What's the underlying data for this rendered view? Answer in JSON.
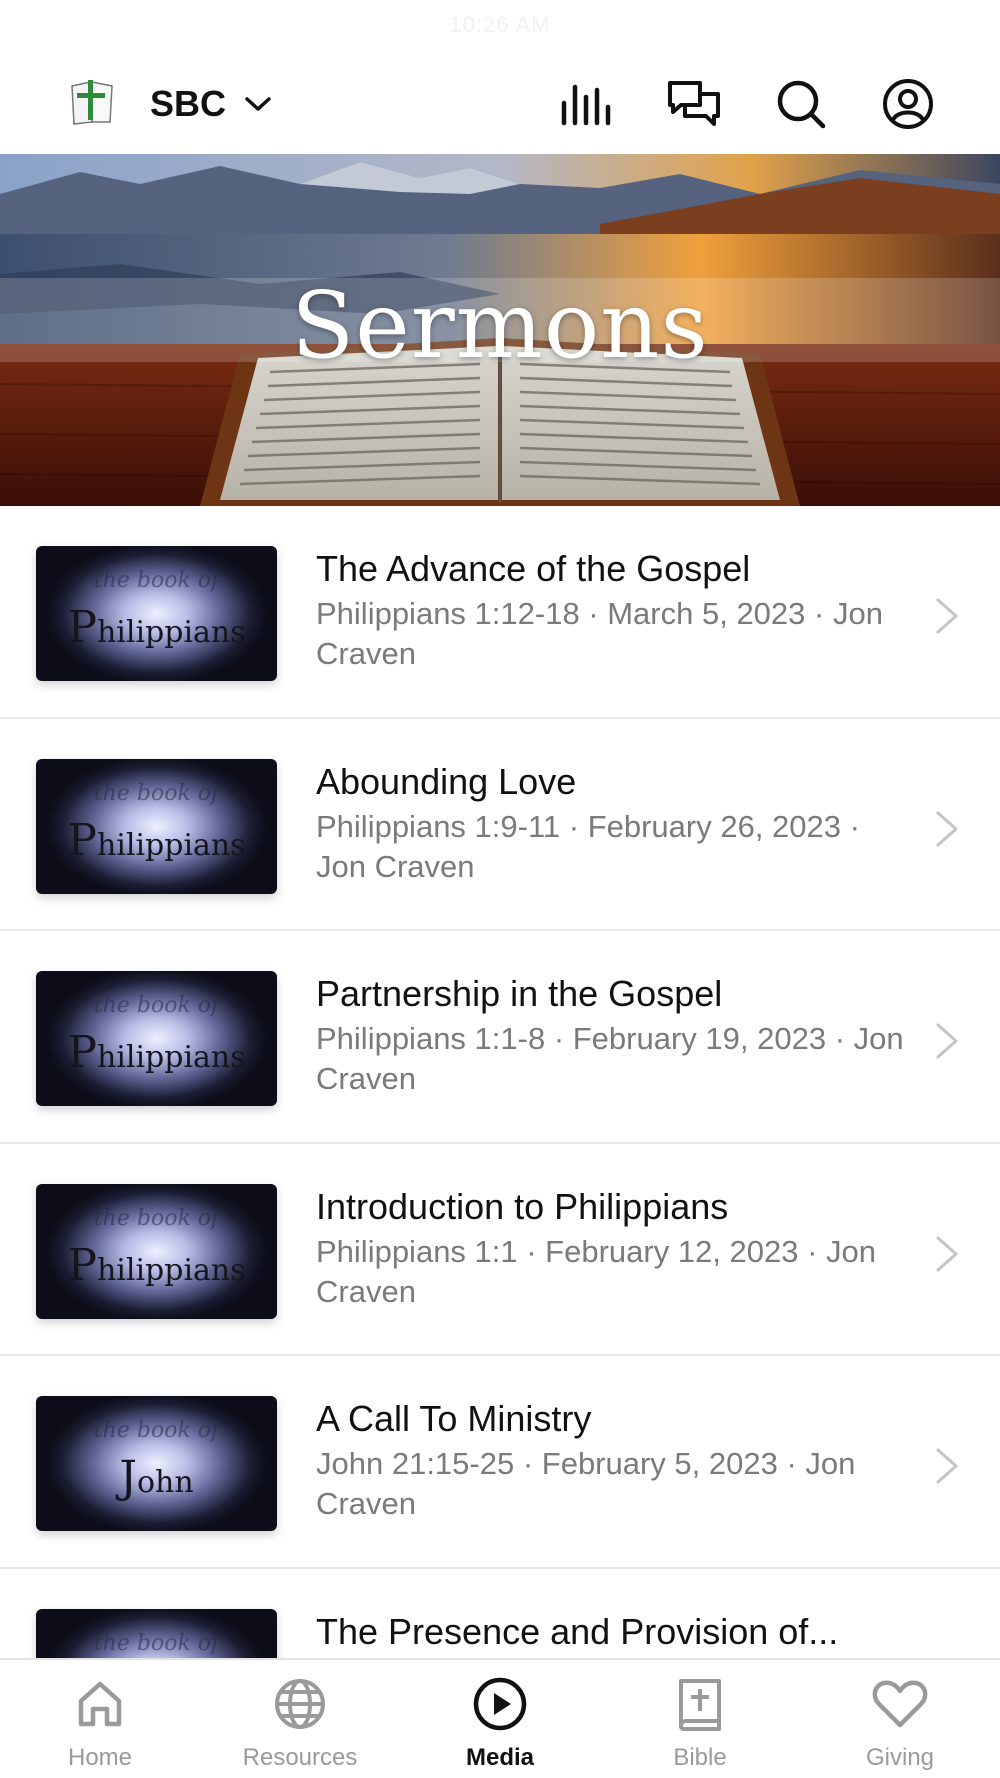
{
  "status_bar": {
    "time": "10:26 AM"
  },
  "header": {
    "org_name": "SBC",
    "icons": [
      "logo-icon",
      "chevron-down-icon",
      "media-levels-icon",
      "chat-icon",
      "search-icon",
      "account-icon"
    ]
  },
  "hero": {
    "title": "Sermons"
  },
  "sermons": [
    {
      "title": "The Advance of the Gospel",
      "meta": "Philippians 1:12-18 · March 5, 2023 · Jon Craven",
      "thumb_small": "the book of",
      "thumb_big": "Philippians"
    },
    {
      "title": "Abounding Love",
      "meta": "Philippians 1:9-11 · February 26, 2023 · Jon Craven",
      "thumb_small": "the book of",
      "thumb_big": "Philippians"
    },
    {
      "title": "Partnership in the Gospel",
      "meta": "Philippians 1:1-8 · February 19, 2023 · Jon Craven",
      "thumb_small": "the book of",
      "thumb_big": "Philippians"
    },
    {
      "title": "Introduction to Philippians",
      "meta": "Philippians 1:1 · February 12, 2023 · Jon Craven",
      "thumb_small": "the book of",
      "thumb_big": "Philippians"
    },
    {
      "title": "A Call To Ministry",
      "meta": "John 21:15-25 · February 5, 2023 · Jon Craven",
      "thumb_small": "the book of",
      "thumb_big": "John"
    },
    {
      "title": "The Presence and Provision of...",
      "meta": "",
      "thumb_small": "the book of",
      "thumb_big": ""
    }
  ],
  "tabs": [
    {
      "label": "Home",
      "icon": "home-icon",
      "active": false
    },
    {
      "label": "Resources",
      "icon": "globe-icon",
      "active": false
    },
    {
      "label": "Media",
      "icon": "play-icon",
      "active": true
    },
    {
      "label": "Bible",
      "icon": "bible-icon",
      "active": false
    },
    {
      "label": "Giving",
      "icon": "heart-icon",
      "active": false
    }
  ],
  "colors": {
    "text_primary": "#111111",
    "text_secondary": "#7a7a7a",
    "divider": "#e6e6e6",
    "tab_inactive": "#9a9a9a"
  }
}
